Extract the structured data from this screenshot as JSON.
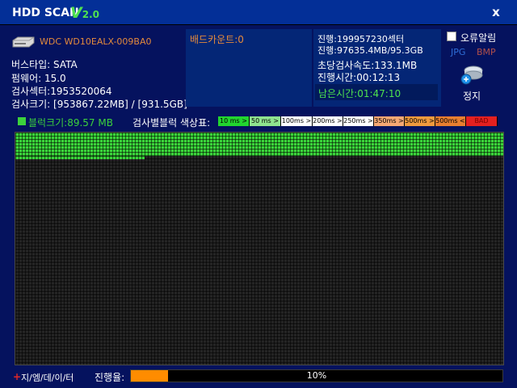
{
  "titlebar": {
    "app_name": "HDD SCAN",
    "version_prefix": "V",
    "version_number": "2.0",
    "close_label": "x"
  },
  "drive": {
    "model": "WDC WD10EALX-009BA0",
    "bus_type": "버스타입: SATA",
    "firmware": "펌웨어: 15.0",
    "sectors": "검사섹터:1953520064",
    "size": "검사크기: [953867.22MB] / [931.5GB]"
  },
  "bad_count": "배드카운트:0",
  "progress_info": {
    "sector_progress": "진행:199957230섹터",
    "size_progress": "진행:97635.4MB/95.3GB",
    "speed": "초당검사속도:133.1MB",
    "elapsed": "진행시간:00:12:13",
    "remaining": "남은시간:01:47:10"
  },
  "options": {
    "error_alarm_label": "오류알림",
    "error_alarm_checked": false,
    "jpg_label": "JPG",
    "bmp_label": "BMP"
  },
  "stop": {
    "label": "정지"
  },
  "block_size": "블럭크기:89.57 MB",
  "color_legend": {
    "label": "검사별블럭 색상표:",
    "chips": [
      {
        "label": "10 ms >",
        "color": "#22d42f"
      },
      {
        "label": "50 ms >",
        "color": "#8fe38f"
      },
      {
        "label": "100ms >",
        "color": "#ffffff"
      },
      {
        "label": "200ms >",
        "color": "#ffffff"
      },
      {
        "label": "250ms >",
        "color": "#ffffff"
      },
      {
        "label": "350ms >",
        "color": "#f6a874"
      },
      {
        "label": "500ms >",
        "color": "#f09a3e"
      },
      {
        "label": "500ms <",
        "color": "#e87f30"
      },
      {
        "label": "BAD",
        "color": "#e42020"
      }
    ]
  },
  "footer": {
    "brand_star": "+",
    "brand": "지/엠/데/이/터",
    "progress_label": "진행율:",
    "progress_text": "10%",
    "progress_value": 10
  },
  "colors": {
    "scanned_block": "#3ad33a",
    "progress_fill": "#ff8c00",
    "background": "#05125e"
  }
}
